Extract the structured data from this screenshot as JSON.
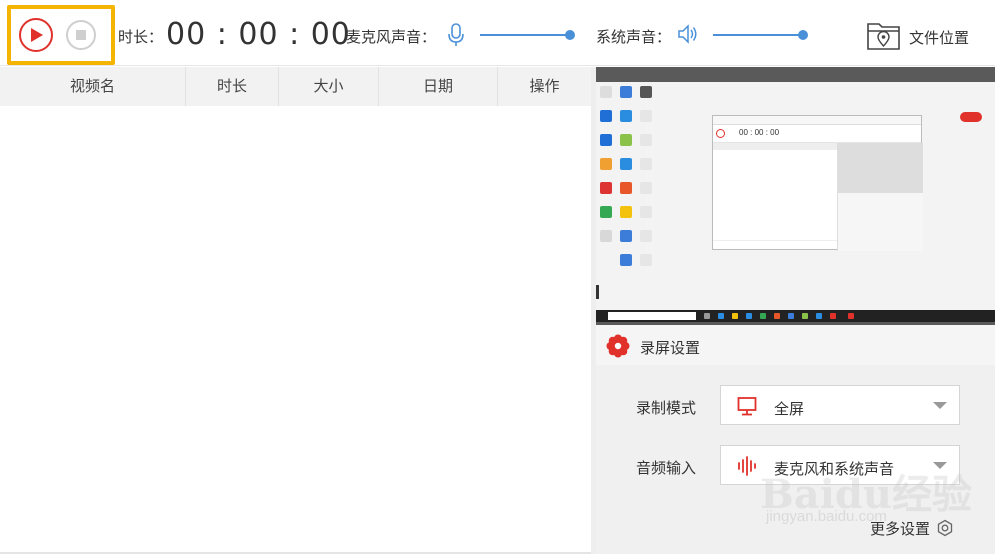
{
  "toolbar": {
    "duration_label": "时长：",
    "timer": "00 : 00 : 00",
    "mic_label": "麦克风声音：",
    "system_sound_label": "系统声音：",
    "folder_label": "文件位置"
  },
  "table": {
    "columns": [
      "视频名",
      "时长",
      "大小",
      "日期",
      "操作"
    ],
    "rows": []
  },
  "preview": {
    "mini_timer": "00 : 00 : 00"
  },
  "settings": {
    "title": "录屏设置",
    "record_mode_label": "录制模式",
    "record_mode_value": "全屏",
    "audio_input_label": "音频输入",
    "audio_input_value": "麦克风和系统声音",
    "more_label": "更多设置"
  },
  "watermark": {
    "logo_text": "Baidu经验",
    "url_text": "jingyan.baidu.com"
  },
  "colors": {
    "accent_red": "#e0322b",
    "highlight_yellow": "#f5b400",
    "slider_blue": "#4a90d9"
  }
}
